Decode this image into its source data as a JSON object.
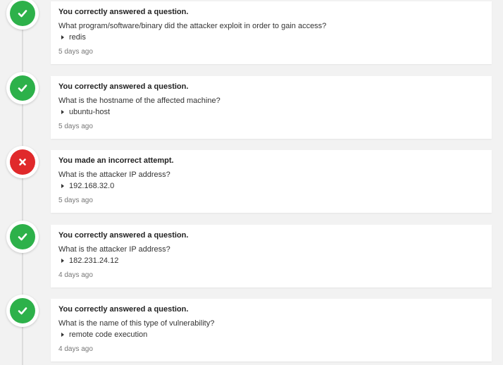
{
  "colors": {
    "correct": "#2db14a",
    "incorrect": "#e0292b",
    "rail": "#dcdcdc"
  },
  "activity": [
    {
      "status": "correct",
      "icon": "check-icon",
      "title": "You correctly answered a question.",
      "question": "What program/software/binary did the attacker exploit in order to gain access?",
      "answer": "redis",
      "time": "5 days ago"
    },
    {
      "status": "correct",
      "icon": "check-icon",
      "title": "You correctly answered a question.",
      "question": "What is the hostname of the affected machine?",
      "answer": "ubuntu-host",
      "time": "5 days ago"
    },
    {
      "status": "incorrect",
      "icon": "cross-icon",
      "title": "You made an incorrect attempt.",
      "question": "What is the attacker IP address?",
      "answer": "192.168.32.0",
      "time": "5 days ago"
    },
    {
      "status": "correct",
      "icon": "check-icon",
      "title": "You correctly answered a question.",
      "question": "What is the attacker IP address?",
      "answer": "182.231.24.12",
      "time": "4 days ago"
    },
    {
      "status": "correct",
      "icon": "check-icon",
      "title": "You correctly answered a question.",
      "question": "What is the name of this type of vulnerability?",
      "answer": "remote code execution",
      "time": "4 days ago"
    }
  ]
}
